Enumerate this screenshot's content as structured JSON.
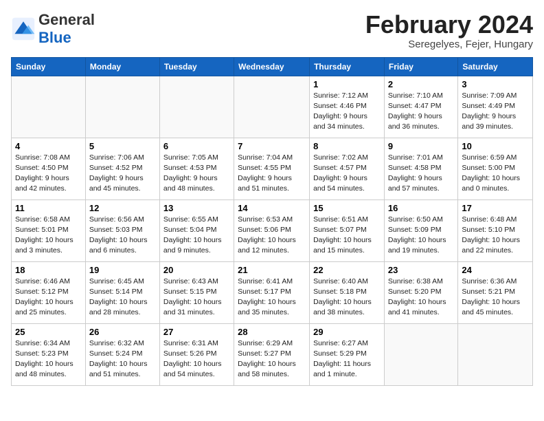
{
  "header": {
    "logo_general": "General",
    "logo_blue": "Blue",
    "title": "February 2024",
    "subtitle": "Seregelyes, Fejer, Hungary"
  },
  "weekdays": [
    "Sunday",
    "Monday",
    "Tuesday",
    "Wednesday",
    "Thursday",
    "Friday",
    "Saturday"
  ],
  "weeks": [
    [
      {
        "day": "",
        "info": ""
      },
      {
        "day": "",
        "info": ""
      },
      {
        "day": "",
        "info": ""
      },
      {
        "day": "",
        "info": ""
      },
      {
        "day": "1",
        "info": "Sunrise: 7:12 AM\nSunset: 4:46 PM\nDaylight: 9 hours\nand 34 minutes."
      },
      {
        "day": "2",
        "info": "Sunrise: 7:10 AM\nSunset: 4:47 PM\nDaylight: 9 hours\nand 36 minutes."
      },
      {
        "day": "3",
        "info": "Sunrise: 7:09 AM\nSunset: 4:49 PM\nDaylight: 9 hours\nand 39 minutes."
      }
    ],
    [
      {
        "day": "4",
        "info": "Sunrise: 7:08 AM\nSunset: 4:50 PM\nDaylight: 9 hours\nand 42 minutes."
      },
      {
        "day": "5",
        "info": "Sunrise: 7:06 AM\nSunset: 4:52 PM\nDaylight: 9 hours\nand 45 minutes."
      },
      {
        "day": "6",
        "info": "Sunrise: 7:05 AM\nSunset: 4:53 PM\nDaylight: 9 hours\nand 48 minutes."
      },
      {
        "day": "7",
        "info": "Sunrise: 7:04 AM\nSunset: 4:55 PM\nDaylight: 9 hours\nand 51 minutes."
      },
      {
        "day": "8",
        "info": "Sunrise: 7:02 AM\nSunset: 4:57 PM\nDaylight: 9 hours\nand 54 minutes."
      },
      {
        "day": "9",
        "info": "Sunrise: 7:01 AM\nSunset: 4:58 PM\nDaylight: 9 hours\nand 57 minutes."
      },
      {
        "day": "10",
        "info": "Sunrise: 6:59 AM\nSunset: 5:00 PM\nDaylight: 10 hours\nand 0 minutes."
      }
    ],
    [
      {
        "day": "11",
        "info": "Sunrise: 6:58 AM\nSunset: 5:01 PM\nDaylight: 10 hours\nand 3 minutes."
      },
      {
        "day": "12",
        "info": "Sunrise: 6:56 AM\nSunset: 5:03 PM\nDaylight: 10 hours\nand 6 minutes."
      },
      {
        "day": "13",
        "info": "Sunrise: 6:55 AM\nSunset: 5:04 PM\nDaylight: 10 hours\nand 9 minutes."
      },
      {
        "day": "14",
        "info": "Sunrise: 6:53 AM\nSunset: 5:06 PM\nDaylight: 10 hours\nand 12 minutes."
      },
      {
        "day": "15",
        "info": "Sunrise: 6:51 AM\nSunset: 5:07 PM\nDaylight: 10 hours\nand 15 minutes."
      },
      {
        "day": "16",
        "info": "Sunrise: 6:50 AM\nSunset: 5:09 PM\nDaylight: 10 hours\nand 19 minutes."
      },
      {
        "day": "17",
        "info": "Sunrise: 6:48 AM\nSunset: 5:10 PM\nDaylight: 10 hours\nand 22 minutes."
      }
    ],
    [
      {
        "day": "18",
        "info": "Sunrise: 6:46 AM\nSunset: 5:12 PM\nDaylight: 10 hours\nand 25 minutes."
      },
      {
        "day": "19",
        "info": "Sunrise: 6:45 AM\nSunset: 5:14 PM\nDaylight: 10 hours\nand 28 minutes."
      },
      {
        "day": "20",
        "info": "Sunrise: 6:43 AM\nSunset: 5:15 PM\nDaylight: 10 hours\nand 31 minutes."
      },
      {
        "day": "21",
        "info": "Sunrise: 6:41 AM\nSunset: 5:17 PM\nDaylight: 10 hours\nand 35 minutes."
      },
      {
        "day": "22",
        "info": "Sunrise: 6:40 AM\nSunset: 5:18 PM\nDaylight: 10 hours\nand 38 minutes."
      },
      {
        "day": "23",
        "info": "Sunrise: 6:38 AM\nSunset: 5:20 PM\nDaylight: 10 hours\nand 41 minutes."
      },
      {
        "day": "24",
        "info": "Sunrise: 6:36 AM\nSunset: 5:21 PM\nDaylight: 10 hours\nand 45 minutes."
      }
    ],
    [
      {
        "day": "25",
        "info": "Sunrise: 6:34 AM\nSunset: 5:23 PM\nDaylight: 10 hours\nand 48 minutes."
      },
      {
        "day": "26",
        "info": "Sunrise: 6:32 AM\nSunset: 5:24 PM\nDaylight: 10 hours\nand 51 minutes."
      },
      {
        "day": "27",
        "info": "Sunrise: 6:31 AM\nSunset: 5:26 PM\nDaylight: 10 hours\nand 54 minutes."
      },
      {
        "day": "28",
        "info": "Sunrise: 6:29 AM\nSunset: 5:27 PM\nDaylight: 10 hours\nand 58 minutes."
      },
      {
        "day": "29",
        "info": "Sunrise: 6:27 AM\nSunset: 5:29 PM\nDaylight: 11 hours\nand 1 minute."
      },
      {
        "day": "",
        "info": ""
      },
      {
        "day": "",
        "info": ""
      }
    ]
  ]
}
